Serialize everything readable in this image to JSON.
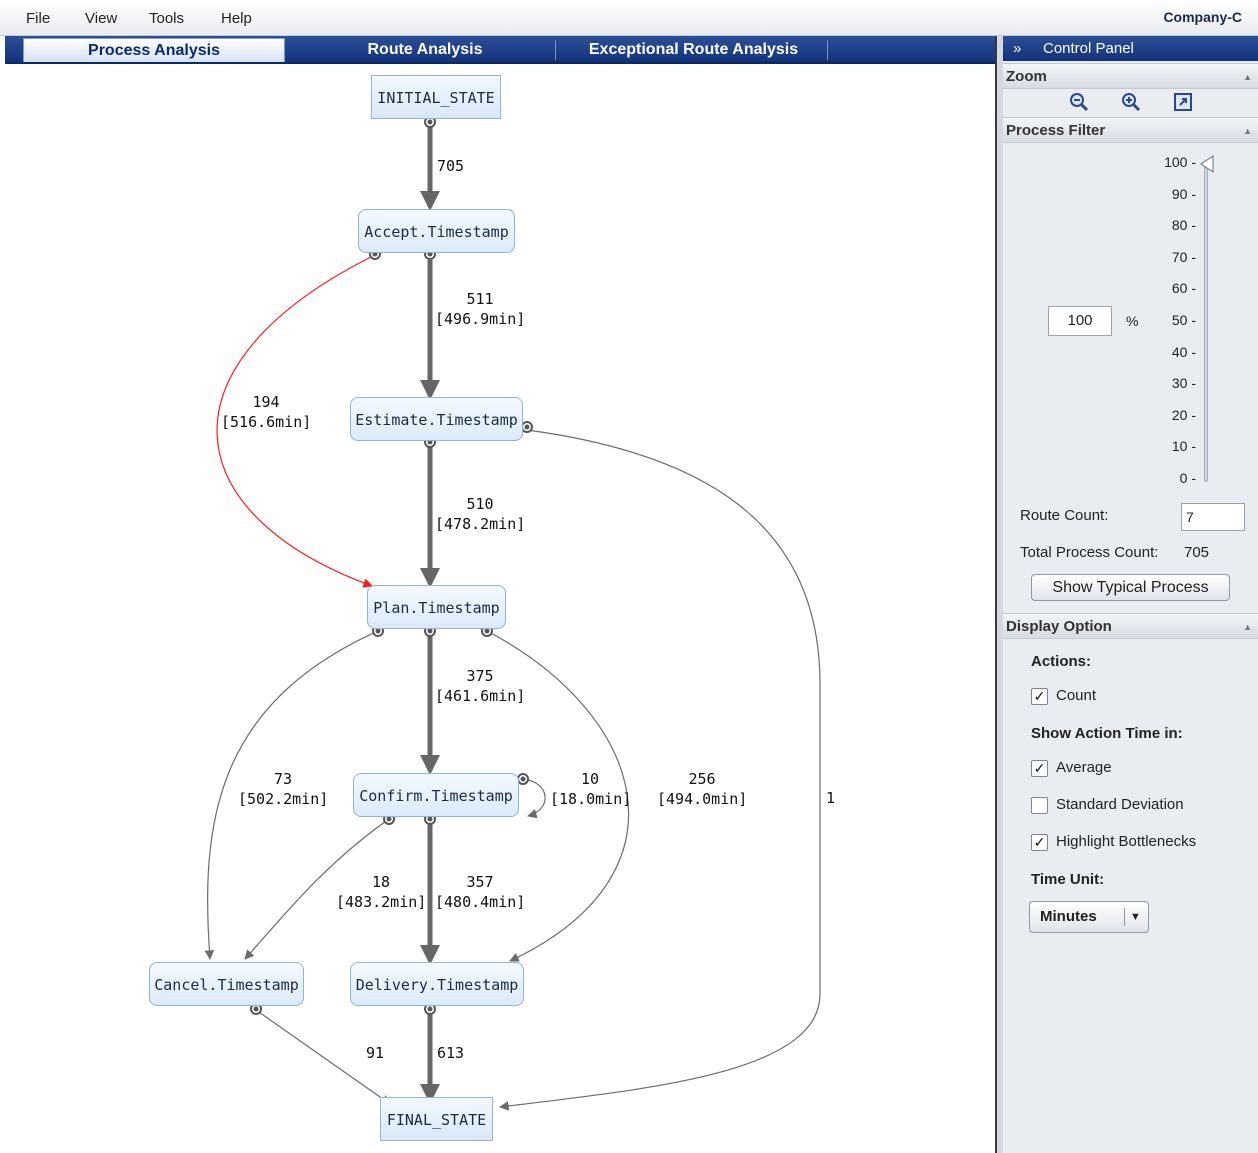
{
  "menu": {
    "items": [
      "File",
      "View",
      "Tools",
      "Help"
    ],
    "company": "Company-C"
  },
  "tabs": [
    {
      "label": "Process Analysis",
      "active": true
    },
    {
      "label": "Route Analysis",
      "active": false
    },
    {
      "label": "Exceptional Route Analysis",
      "active": false
    }
  ],
  "graph": {
    "nodes": {
      "initial": "INITIAL_STATE",
      "accept": "Accept.Timestamp",
      "estimate": "Estimate.Timestamp",
      "plan": "Plan.Timestamp",
      "confirm": "Confirm.Timestamp",
      "cancel": "Cancel.Timestamp",
      "delivery": "Delivery.Timestamp",
      "final": "FINAL_STATE"
    },
    "edges": {
      "initial_accept": {
        "count": "705",
        "time": ""
      },
      "accept_estimate": {
        "count": "511",
        "time": "[496.9min]"
      },
      "accept_plan": {
        "count": "194",
        "time": "[516.6min]"
      },
      "estimate_plan": {
        "count": "510",
        "time": "[478.2min]"
      },
      "estimate_final": {
        "count": "1",
        "time": ""
      },
      "plan_confirm": {
        "count": "375",
        "time": "[461.6min]"
      },
      "plan_cancel": {
        "count": "73",
        "time": "[502.2min]"
      },
      "plan_delivery": {
        "count": "256",
        "time": "[494.0min]"
      },
      "confirm_loop": {
        "count": "10",
        "time": "[18.0min]"
      },
      "confirm_cancel": {
        "count": "18",
        "time": "[483.2min]"
      },
      "confirm_delivery": {
        "count": "357",
        "time": "[480.4min]"
      },
      "cancel_final": {
        "count": "91",
        "time": ""
      },
      "delivery_final": {
        "count": "613",
        "time": ""
      }
    },
    "colors": {
      "normal": "#6b6b6b",
      "bottleneck": "#ff1a1a",
      "main": "#666666"
    }
  },
  "control_panel": {
    "title": "Control Panel",
    "toggle_icon": "»",
    "zoom": {
      "title": "Zoom",
      "buttons": [
        "zoom-out-icon",
        "zoom-in-icon",
        "fit-icon"
      ]
    },
    "process_filter": {
      "title": "Process Filter",
      "ticks": [
        "100 -",
        "90 -",
        "80 -",
        "70 -",
        "60 -",
        "50 -",
        "40 -",
        "30 -",
        "20 -",
        "10 -",
        "0 -"
      ],
      "slider_value": 100,
      "percent_value": "100",
      "percent_label": "%",
      "route_count_label": "Route Count:",
      "route_count_value": "7",
      "total_label": "Total Process Count:",
      "total_value": "705",
      "show_button": "Show Typical Process"
    },
    "display_option": {
      "title": "Display Option",
      "actions_label": "Actions:",
      "count_label": "Count",
      "count_checked": true,
      "show_time_label": "Show Action Time in:",
      "average_label": "Average",
      "average_checked": true,
      "stddev_label": "Standard Deviation",
      "stddev_checked": false,
      "highlight_label": "Highlight Bottlenecks",
      "highlight_checked": true,
      "time_unit_label": "Time Unit:",
      "time_unit_value": "Minutes"
    }
  }
}
